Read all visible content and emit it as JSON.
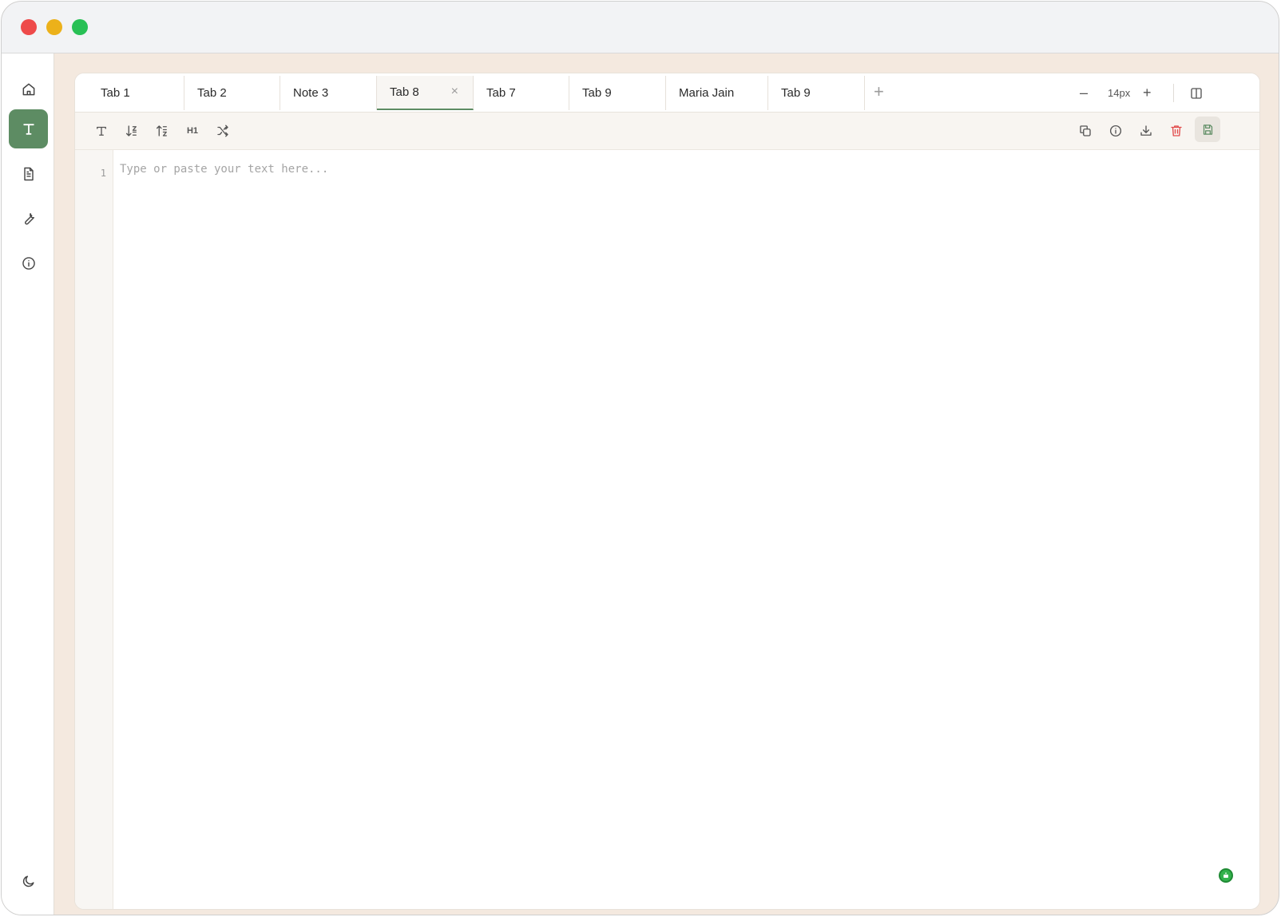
{
  "tabs": [
    {
      "label": "Tab 1",
      "active": false
    },
    {
      "label": "Tab 2",
      "active": false
    },
    {
      "label": "Note 3",
      "active": false
    },
    {
      "label": "Tab 8",
      "active": true,
      "close": "×"
    },
    {
      "label": "Tab 7",
      "active": false
    },
    {
      "label": "Tab 9",
      "active": false
    },
    {
      "label": "Maria Jain",
      "active": false
    },
    {
      "label": "Tab 9",
      "active": false
    }
  ],
  "add_tab_label": "+",
  "zoom": {
    "minus": "–",
    "value": "14px",
    "plus": "+"
  },
  "editor": {
    "line_numbers": [
      "1"
    ],
    "placeholder": "Type or paste your text here..."
  },
  "toolbar": {
    "left_tools": [
      "text-format-icon",
      "sort-desc-icon",
      "sort-asc-icon",
      "heading-icon",
      "shuffle-icon"
    ],
    "heading_label": "H1",
    "right_tools": [
      "copy-icon",
      "info-icon",
      "download-icon",
      "delete-icon",
      "save-icon"
    ]
  },
  "sidebar": {
    "items": [
      "home-icon",
      "text-icon",
      "document-icon",
      "wrench-icon",
      "info-icon"
    ],
    "active": "text-icon",
    "bottom": "moon-icon"
  },
  "colors": {
    "accent": "#5d8c63",
    "danger": "#e14a4a",
    "background": "#f4e9df"
  }
}
